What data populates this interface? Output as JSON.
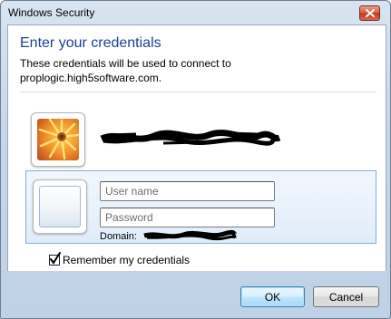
{
  "window": {
    "title": "Windows Security",
    "close_icon": "close-icon"
  },
  "dialog": {
    "heading": "Enter your credentials",
    "description_line1": "These credentials will be used to connect to",
    "description_line2": "proplogic.high5software.com."
  },
  "saved_account": {
    "avatar": "flower-picture",
    "name_redacted": true
  },
  "new_credential": {
    "tile_icon": "blank-user-tile",
    "username_placeholder": "User name",
    "username_value": "",
    "password_placeholder": "Password",
    "password_value": "",
    "domain_label": "Domain:",
    "domain_redacted": true
  },
  "remember": {
    "label": "Remember my credentials",
    "checked": true
  },
  "buttons": {
    "ok": "OK",
    "cancel": "Cancel"
  },
  "colors": {
    "heading": "#1e3f91",
    "selection_border": "#84acdd",
    "close_button": "#c0391b"
  }
}
